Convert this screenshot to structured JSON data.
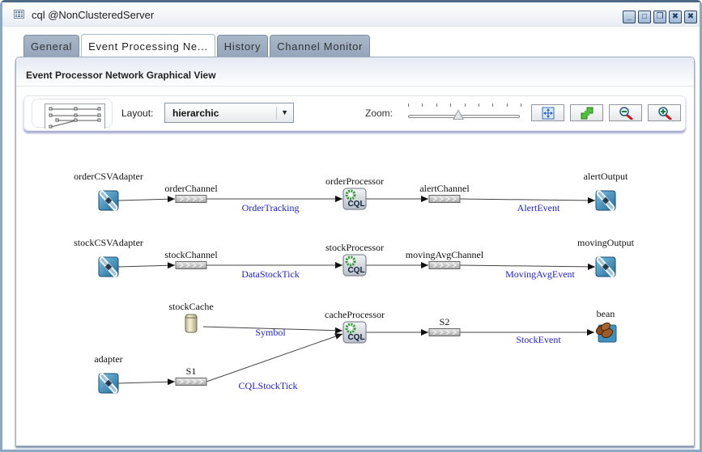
{
  "window": {
    "title": "cql @NonClusteredServer",
    "icon": "table-grid-icon",
    "controls": [
      {
        "name": "minimize-button",
        "glyph": "_",
        "icon": "minimize-icon"
      },
      {
        "name": "maximize-button",
        "glyph": "□",
        "icon": "maximize-icon"
      },
      {
        "name": "restore-button",
        "glyph": "❐",
        "icon": "restore-icon"
      },
      {
        "name": "close-all-button",
        "glyph": "✖",
        "icon": "close-all-icon"
      },
      {
        "name": "close-button",
        "glyph": "✖",
        "icon": "close-icon"
      }
    ]
  },
  "tabs": [
    {
      "label": "General",
      "active": false
    },
    {
      "label": "Event Processing Ne...",
      "active": true
    },
    {
      "label": "History",
      "active": false
    },
    {
      "label": "Channel Monitor",
      "active": false
    }
  ],
  "panel": {
    "title": "Event Processor Network Graphical View"
  },
  "toolbar": {
    "layout_label": "Layout:",
    "layout_value": "hierarchic",
    "zoom_label": "Zoom:",
    "zoom_level": 0.45,
    "zoom_ticks": 9,
    "buttons": [
      {
        "name": "fit-to-window-button",
        "icon": "fit-content-icon"
      },
      {
        "name": "actual-size-button",
        "icon": "resize-icon"
      },
      {
        "name": "zoom-out-button",
        "icon": "zoom-out-icon"
      },
      {
        "name": "zoom-in-button",
        "icon": "zoom-in-icon"
      }
    ]
  },
  "graph": {
    "colors": {
      "edge": "#444444",
      "edge_label": "#2020d8",
      "processor_gear": "#2e9a2e"
    },
    "nodes": [
      {
        "id": "orderCSVAdapter",
        "label": "orderCSVAdapter",
        "type": "adapter"
      },
      {
        "id": "orderChannel",
        "label": "orderChannel",
        "type": "channel"
      },
      {
        "id": "orderProcessor",
        "label": "orderProcessor",
        "type": "processor",
        "badge": "CQL"
      },
      {
        "id": "alertChannel",
        "label": "alertChannel",
        "type": "channel"
      },
      {
        "id": "alertOutput",
        "label": "alertOutput",
        "type": "adapter"
      },
      {
        "id": "stockCSVAdapter",
        "label": "stockCSVAdapter",
        "type": "adapter"
      },
      {
        "id": "stockChannel",
        "label": "stockChannel",
        "type": "channel"
      },
      {
        "id": "stockProcessor",
        "label": "stockProcessor",
        "type": "processor",
        "badge": "CQL"
      },
      {
        "id": "movingAvgChannel",
        "label": "movingAvgChannel",
        "type": "channel"
      },
      {
        "id": "movingOutput",
        "label": "movingOutput",
        "type": "adapter"
      },
      {
        "id": "stockCache",
        "label": "stockCache",
        "type": "cache"
      },
      {
        "id": "cacheProcessor",
        "label": "cacheProcessor",
        "type": "processor",
        "badge": "CQL"
      },
      {
        "id": "S2",
        "label": "S2",
        "type": "channel"
      },
      {
        "id": "bean",
        "label": "bean",
        "type": "bean"
      },
      {
        "id": "adapter",
        "label": "adapter",
        "type": "adapter"
      },
      {
        "id": "S1",
        "label": "S1",
        "type": "channel"
      }
    ],
    "edges": [
      {
        "from": "orderCSVAdapter",
        "to": "orderChannel",
        "label": ""
      },
      {
        "from": "orderChannel",
        "to": "orderProcessor",
        "label": "OrderTracking"
      },
      {
        "from": "orderProcessor",
        "to": "alertChannel",
        "label": ""
      },
      {
        "from": "alertChannel",
        "to": "alertOutput",
        "label": "AlertEvent"
      },
      {
        "from": "stockCSVAdapter",
        "to": "stockChannel",
        "label": ""
      },
      {
        "from": "stockChannel",
        "to": "stockProcessor",
        "label": "DataStockTick"
      },
      {
        "from": "stockProcessor",
        "to": "movingAvgChannel",
        "label": ""
      },
      {
        "from": "movingAvgChannel",
        "to": "movingOutput",
        "label": "MovingAvgEvent"
      },
      {
        "from": "stockCache",
        "to": "cacheProcessor",
        "label": "Symbol"
      },
      {
        "from": "cacheProcessor",
        "to": "S2",
        "label": ""
      },
      {
        "from": "S2",
        "to": "bean",
        "label": "StockEvent"
      },
      {
        "from": "adapter",
        "to": "S1",
        "label": ""
      },
      {
        "from": "S1",
        "to": "cacheProcessor",
        "label": "CQLStockTick"
      }
    ]
  }
}
